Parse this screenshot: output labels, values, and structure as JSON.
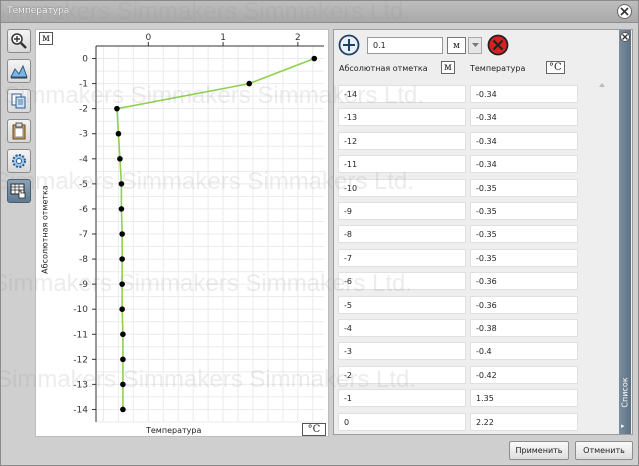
{
  "window": {
    "title": "Температура"
  },
  "watermark": "Simmakers Simmakers Simmakers Ltd.",
  "toolbar": {
    "tools": [
      {
        "name": "zoom-in-tool",
        "icon": "magnifier-plus-icon"
      },
      {
        "name": "fit-view-tool",
        "icon": "mountain-chart-icon"
      },
      {
        "name": "copy-tool",
        "icon": "copy-documents-icon"
      },
      {
        "name": "paste-tool",
        "icon": "clipboard-icon"
      },
      {
        "name": "settings-tool",
        "icon": "gear-icon"
      },
      {
        "name": "table-tool",
        "icon": "table-hand-icon"
      }
    ]
  },
  "chart": {
    "y_unit": "м",
    "x_unit": "°C",
    "ylabel": "Абсолютная отметка",
    "xlabel": "Температура"
  },
  "chart_data": {
    "type": "line",
    "x": [
      -0.34,
      -0.34,
      -0.34,
      -0.34,
      -0.35,
      -0.35,
      -0.35,
      -0.35,
      -0.36,
      -0.36,
      -0.38,
      -0.4,
      -0.42,
      1.35,
      2.22
    ],
    "y": [
      -14,
      -13,
      -12,
      -11,
      -10,
      -9,
      -8,
      -7,
      -6,
      -5,
      -4,
      -3,
      -2,
      -1,
      0
    ],
    "xticks": [
      0,
      1,
      2
    ],
    "yticks": [
      0,
      -1,
      -2,
      -3,
      -4,
      -5,
      -6,
      -7,
      -8,
      -9,
      -10,
      -11,
      -12,
      -13,
      -14
    ],
    "xlim": [
      -0.7,
      2.35
    ],
    "ylim": [
      -14.5,
      0.5
    ],
    "grid": true,
    "xaxis_position": "top",
    "line_color": "#8fd14f",
    "marker_color": "#000000"
  },
  "list": {
    "step_value": "0.1",
    "unit": "м",
    "col1_header": "Абсолютная отметка",
    "col1_unit": "м",
    "col2_header": "Температура",
    "col2_unit": "°C",
    "rows": [
      {
        "depth": "-14",
        "temp": "-0.34"
      },
      {
        "depth": "-13",
        "temp": "-0.34"
      },
      {
        "depth": "-12",
        "temp": "-0.34"
      },
      {
        "depth": "-11",
        "temp": "-0.34"
      },
      {
        "depth": "-10",
        "temp": "-0.35"
      },
      {
        "depth": "-9",
        "temp": "-0.35"
      },
      {
        "depth": "-8",
        "temp": "-0.35"
      },
      {
        "depth": "-7",
        "temp": "-0.35"
      },
      {
        "depth": "-6",
        "temp": "-0.36"
      },
      {
        "depth": "-5",
        "temp": "-0.36"
      },
      {
        "depth": "-4",
        "temp": "-0.38"
      },
      {
        "depth": "-3",
        "temp": "-0.4"
      },
      {
        "depth": "-2",
        "temp": "-0.42"
      },
      {
        "depth": "-1",
        "temp": "1.35"
      },
      {
        "depth": "0",
        "temp": "2.22"
      }
    ],
    "side_tab_label": "Список"
  },
  "footer": {
    "apply_label": "Применить",
    "cancel_label": "Отменить"
  }
}
